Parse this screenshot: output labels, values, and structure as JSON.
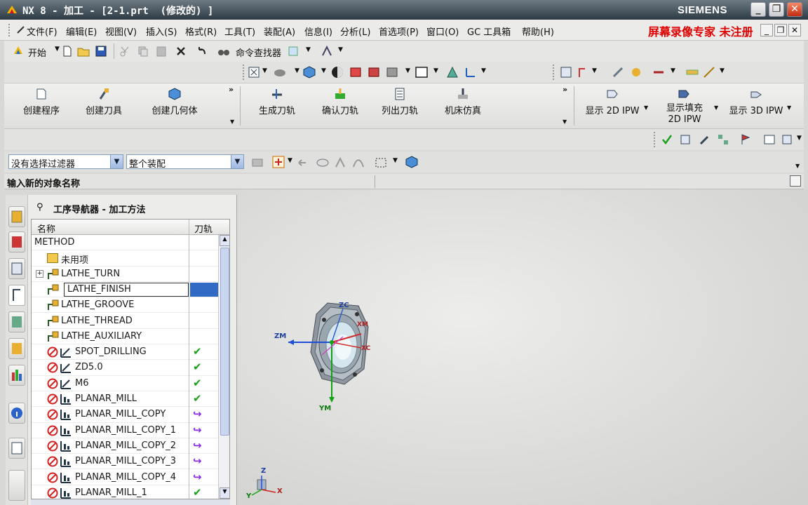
{
  "titlebar": {
    "title": "NX 8 - 加工 - [2-1.prt  (修改的) ]",
    "brand": "SIEMENS"
  },
  "watermark": "屏幕录像专家  未注册",
  "menubar": {
    "items": [
      "文件(F)",
      "编辑(E)",
      "视图(V)",
      "插入(S)",
      "格式(R)",
      "工具(T)",
      "装配(A)",
      "信息(I)",
      "分析(L)",
      "首选项(P)",
      "窗口(O)",
      "GC 工具箱",
      "帮助(H)"
    ]
  },
  "toolbar1": {
    "start_label": "开始",
    "command_finder": "命令查找器"
  },
  "ribbon": {
    "group1": [
      "创建程序",
      "创建刀具",
      "创建几何体"
    ],
    "group2": [
      "生成刀轨",
      "确认刀轨",
      "列出刀轨",
      "机床仿真"
    ],
    "group3": [
      "显示 2D IPW",
      "显示填充 2D IPW",
      "显示 3D IPW"
    ]
  },
  "filter": {
    "selection_filter": "没有选择过滤器",
    "scope": "整个装配"
  },
  "cue": "输入新的对象名称",
  "navigator": {
    "title": "工序导航器 - 加工方法",
    "col_name": "名称",
    "col_path": "刀轨",
    "rows": [
      {
        "name": "METHOD",
        "status": ""
      },
      {
        "name": "未用项",
        "status": ""
      },
      {
        "name": "LATHE_TURN",
        "status": ""
      },
      {
        "name": "LATHE_FINISH",
        "status": ""
      },
      {
        "name": "LATHE_GROOVE",
        "status": ""
      },
      {
        "name": "LATHE_THREAD",
        "status": ""
      },
      {
        "name": "LATHE_AUXILIARY",
        "status": ""
      },
      {
        "name": "SPOT_DRILLING",
        "status": "✔"
      },
      {
        "name": "ZD5.0",
        "status": "✔"
      },
      {
        "name": "M6",
        "status": "✔"
      },
      {
        "name": "PLANAR_MILL",
        "status": "✔"
      },
      {
        "name": "PLANAR_MILL_COPY",
        "status": "↪"
      },
      {
        "name": "PLANAR_MILL_COPY_1",
        "status": "↪"
      },
      {
        "name": "PLANAR_MILL_COPY_2",
        "status": "↪"
      },
      {
        "name": "PLANAR_MILL_COPY_3",
        "status": "↪"
      },
      {
        "name": "PLANAR_MILL_COPY_4",
        "status": "↪"
      },
      {
        "name": "PLANAR_MILL_1",
        "status": "✔"
      }
    ]
  },
  "viewport": {
    "axes": {
      "zm": "ZM",
      "zc": "ZC",
      "ym": "YM",
      "xm": "XM",
      "xc": "XC"
    },
    "triad": {
      "z": "Z",
      "x": "X",
      "y": "Y"
    }
  },
  "colors": {
    "check": "#1aa01a",
    "retarget": "#8a2be2",
    "forbidden": "#d42020",
    "selection": "#316ac5"
  }
}
